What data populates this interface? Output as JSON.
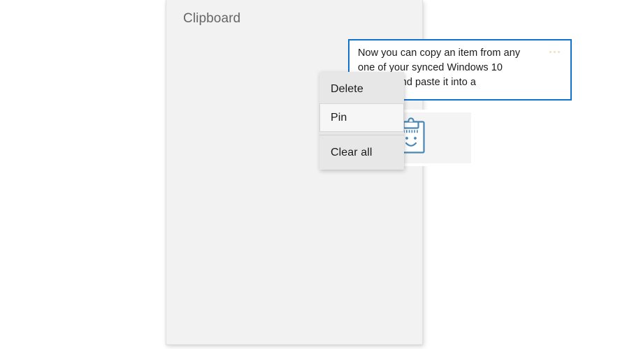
{
  "page": {
    "background_color": "#ffffff"
  },
  "panel": {
    "title": "Clipboard",
    "background_color": "#f2f2f2"
  },
  "clipboard_item": {
    "text": "Now you can copy an item from any one of your synced Windows 10 devices and paste it into a",
    "more_icon": "ellipsis-icon",
    "border_color": "#1273cf",
    "selected": true
  },
  "clipboard_smiley_item": {
    "icon": "clipboard-smiley-icon",
    "icon_color": "#4a87b5"
  },
  "context_menu": {
    "items": [
      {
        "label": "Delete",
        "hovered": false,
        "separator_before": false
      },
      {
        "label": "Pin",
        "hovered": true,
        "separator_before": false
      },
      {
        "label": "Clear all",
        "hovered": false,
        "separator_before": true
      }
    ],
    "background_color": "#e7e7e7",
    "hover_color": "#f6f6f6"
  }
}
